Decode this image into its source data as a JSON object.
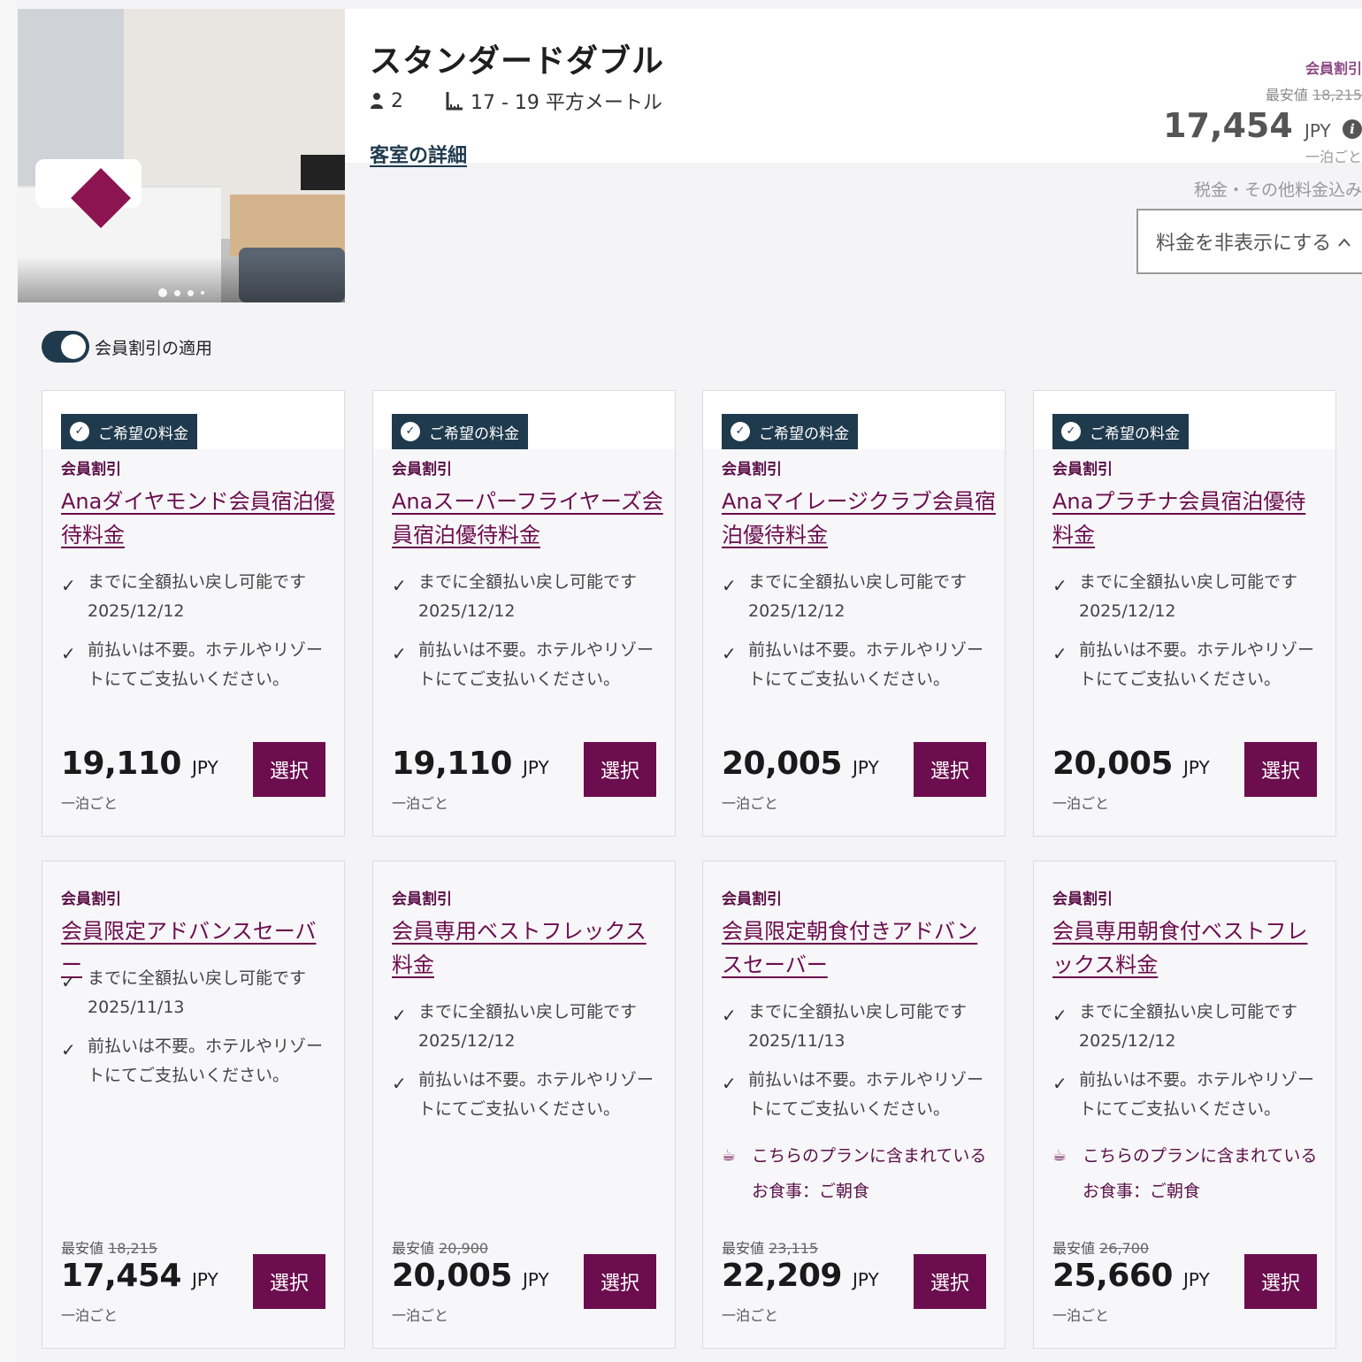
{
  "room": {
    "title": "スタンダードダブル",
    "guests": "2",
    "size": "17 - 19 平方メートル",
    "details_link": "客室の詳細"
  },
  "top_price": {
    "discount_label": "会員割引",
    "lowest_label": "最安値",
    "lowest_value": "18,215",
    "price": "17,454",
    "currency": "JPY",
    "per_night": "一泊ごと",
    "tax_note": "税金・その他料金込み"
  },
  "hide_button": "料金を非表示にする",
  "toggle_label": "会員割引の適用",
  "carousel": {
    "slides": 4,
    "active": 0
  },
  "common": {
    "badge": "ご希望の料金",
    "tag": "会員割引",
    "per_night": "一泊ごと",
    "select": "選択",
    "currency": "JPY",
    "lowest_label": "最安値",
    "refund_text": "までに全額払い戻し可能です",
    "pay_text": "前払いは不要。ホテルやリゾートにてご支払いください。",
    "meal_text": "こちらのプランに含まれているお食事：ご朝食"
  },
  "cards": [
    {
      "rate": "Anaダイヤモンド会員宿泊優待料金",
      "date": "2025/12/12",
      "price": "19,110",
      "lowest": "",
      "badge": true,
      "meal": false
    },
    {
      "rate": "Anaスーパーフライヤーズ会員宿泊優待料金",
      "date": "2025/12/12",
      "price": "19,110",
      "lowest": "",
      "badge": true,
      "meal": false
    },
    {
      "rate": "Anaマイレージクラブ会員宿泊優待料金",
      "date": "2025/12/12",
      "price": "20,005",
      "lowest": "",
      "badge": true,
      "meal": false
    },
    {
      "rate": "Anaプラチナ会員宿泊優待料金",
      "date": "2025/12/12",
      "price": "20,005",
      "lowest": "",
      "badge": true,
      "meal": false
    },
    {
      "rate": "会員限定アドバンスセーバー",
      "date": "2025/11/13",
      "price": "17,454",
      "lowest": "18,215",
      "badge": false,
      "meal": false
    },
    {
      "rate": "会員専用ベストフレックス料金",
      "date": "2025/12/12",
      "price": "20,005",
      "lowest": "20,900",
      "badge": false,
      "meal": false
    },
    {
      "rate": "会員限定朝食付きアドバンスセーバー",
      "date": "2025/11/13",
      "price": "22,209",
      "lowest": "23,115",
      "badge": false,
      "meal": true
    },
    {
      "rate": "会員専用朝食付ベストフレックス料金",
      "date": "2025/12/12",
      "price": "25,660",
      "lowest": "26,700",
      "badge": false,
      "meal": true
    }
  ]
}
